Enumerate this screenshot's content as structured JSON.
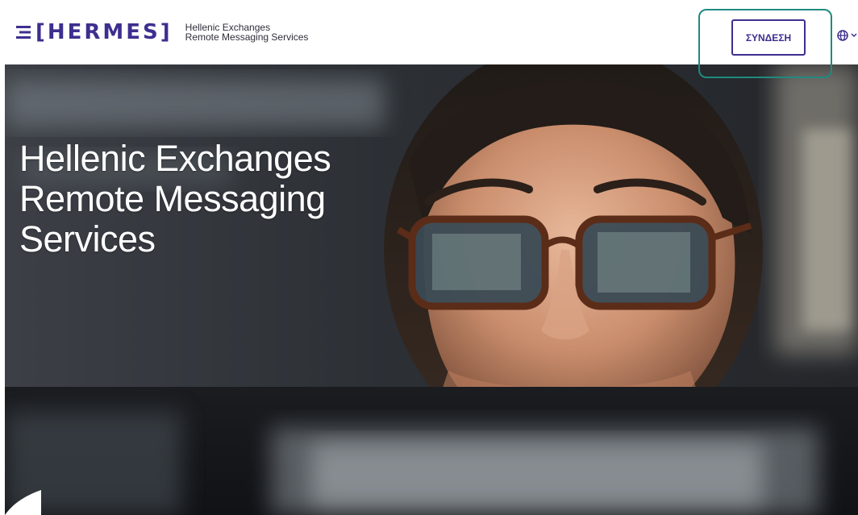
{
  "header": {
    "logo": {
      "brand": "[HERMES]",
      "tagline_line1": "Hellenic Exchanges",
      "tagline_line2": "Remote Messaging Services"
    },
    "login_label": "ΣΥΝΔΕΣΗ",
    "language_icon": "globe-icon",
    "language_chevron": "chevron-down-icon"
  },
  "hero": {
    "title_line1": "Hellenic Exchanges",
    "title_line2": "Remote Messaging",
    "title_line3": "Services",
    "image": "woman-with-glasses-reflecting-screens-photo"
  },
  "colors": {
    "brand": "#3d2f8f",
    "highlight": "#1f8a7f",
    "hero_text": "#ffffff"
  }
}
